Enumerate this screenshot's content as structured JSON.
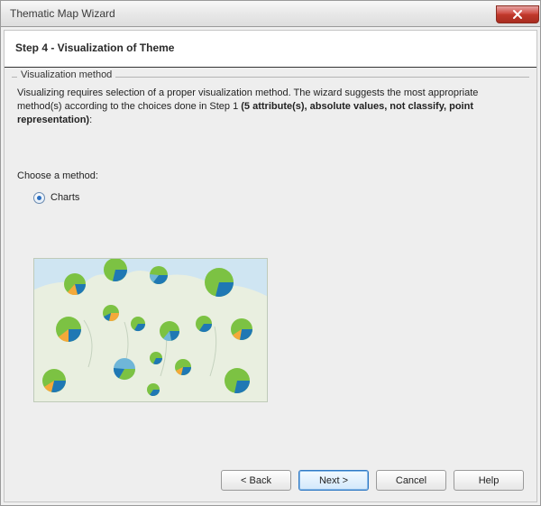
{
  "titlebar": {
    "title": "Thematic Map Wizard"
  },
  "header": {
    "step_title": "Step 4 - Visualization of Theme"
  },
  "group": {
    "label": "Visualization method",
    "intro_prefix": "Visualizing requires selection of a proper visualization method. The wizard suggests the most appropriate method(s) according to the choices done in Step 1 ",
    "intro_bold": "(5 attribute(s), absolute values, not classify, point representation)",
    "intro_suffix": ":",
    "choose_label": "Choose a method:",
    "options": {
      "charts": "Charts"
    }
  },
  "buttons": {
    "back": "< Back",
    "next": "Next >",
    "cancel": "Cancel",
    "help": "Help"
  }
}
